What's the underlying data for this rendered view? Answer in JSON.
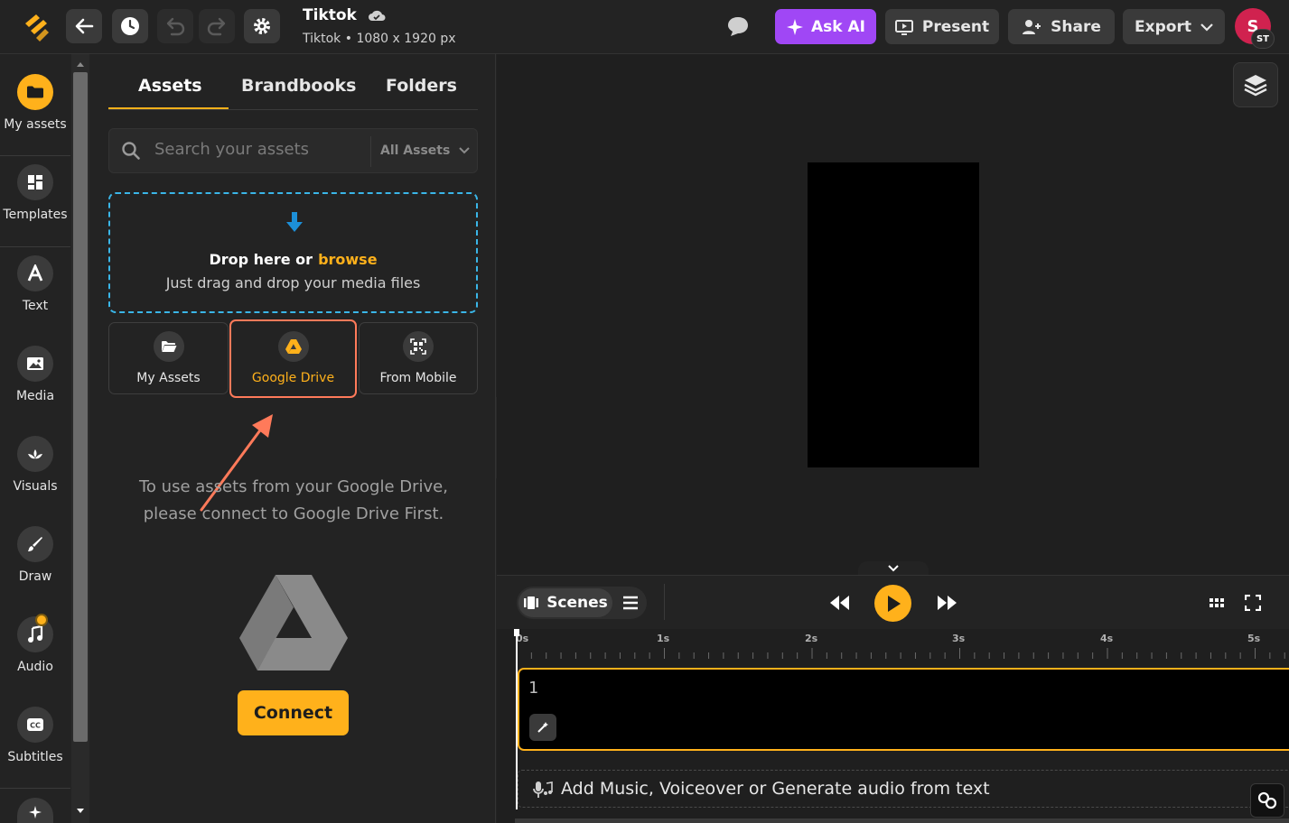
{
  "header": {
    "project_title": "Tiktok",
    "project_subtitle": "Tiktok • 1080 x 1920 px",
    "ask_ai_label": "Ask AI",
    "present_label": "Present",
    "share_label": "Share",
    "export_label": "Export",
    "avatar_initial": "S",
    "avatar_badge": "ST"
  },
  "rail": {
    "items": [
      {
        "label": "My assets",
        "icon": "folder-icon"
      },
      {
        "label": "Templates",
        "icon": "templates-icon"
      },
      {
        "label": "Text",
        "icon": "text-icon"
      },
      {
        "label": "Media",
        "icon": "image-icon"
      },
      {
        "label": "Visuals",
        "icon": "visuals-icon"
      },
      {
        "label": "Draw",
        "icon": "brush-icon"
      },
      {
        "label": "Audio",
        "icon": "music-icon"
      },
      {
        "label": "Subtitles",
        "icon": "cc-icon"
      }
    ]
  },
  "panel": {
    "tabs": [
      {
        "label": "Assets"
      },
      {
        "label": "Brandbooks"
      },
      {
        "label": "Folders"
      }
    ],
    "search_placeholder": "Search your assets",
    "filter_label": "All Assets",
    "drop_main": "Drop here or",
    "drop_browse": "browse",
    "drop_sub": "Just drag and drop your media files",
    "sources": [
      {
        "label": "My Assets"
      },
      {
        "label": "Google Drive"
      },
      {
        "label": "From Mobile"
      }
    ],
    "gdrive_message": "To use assets from your Google Drive, please connect to Google Drive First.",
    "connect_label": "Connect"
  },
  "player": {
    "scenes_label": "Scenes"
  },
  "timeline": {
    "ruler": [
      "0s",
      "1s",
      "2s",
      "3s",
      "4s",
      "5s"
    ],
    "scene_number": "1",
    "audio_prompt": "Add Music, Voiceover or Generate audio from text"
  },
  "colors": {
    "accent": "#ffb11b",
    "ask_ai": "#a047f5",
    "highlight": "#ff7a5a",
    "dropzone_border": "#3ab6e8",
    "avatar": "#d0224f"
  }
}
